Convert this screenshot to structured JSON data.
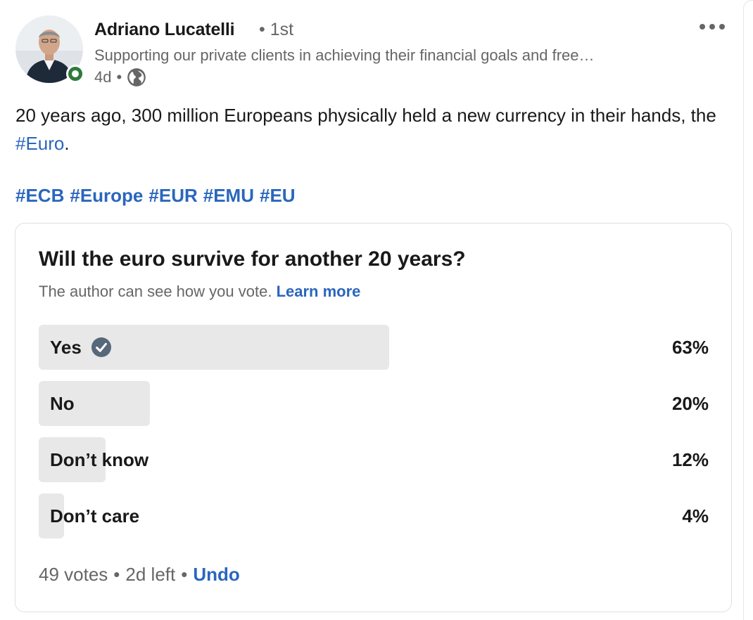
{
  "author": {
    "name": "Adriano Lucatelli",
    "degree": "• 1st",
    "headline": "Supporting our private clients in achieving their financial goals and free…",
    "age": "4d",
    "separator": "•"
  },
  "post": {
    "text_before": "20 years ago, 300 million Europeans physically held a new currency in their hands, the ",
    "inline_hashtag": "#Euro",
    "text_after": ".",
    "hashtags": [
      "#ECB",
      "#Europe",
      "#EUR",
      "#EMU",
      "#EU"
    ]
  },
  "poll": {
    "question": "Will the euro survive for another 20 years?",
    "note": "The author can see how you vote.",
    "learn_more": "Learn more",
    "options": [
      {
        "label": "Yes",
        "percent_label": "63%",
        "share": 0.63,
        "voted": true
      },
      {
        "label": "No",
        "percent_label": "20%",
        "share": 0.2,
        "voted": false
      },
      {
        "label": "Don’t know",
        "percent_label": "12%",
        "share": 0.12,
        "voted": false
      },
      {
        "label": "Don’t care",
        "percent_label": "4%",
        "share": 0.04,
        "voted": false
      }
    ],
    "footer": {
      "votes": "49 votes",
      "sep1": "•",
      "time_left": "2d left",
      "sep2": "•",
      "undo": "Undo"
    }
  },
  "colors": {
    "link": "#2a66bd",
    "muted": "#666666",
    "bar": "#e8e8e8",
    "presence": "#2e7a3c",
    "check": "#56687a"
  },
  "icons": {
    "more": "more-horizontal-icon",
    "visibility": "globe-icon",
    "voted": "check-circle-icon"
  }
}
